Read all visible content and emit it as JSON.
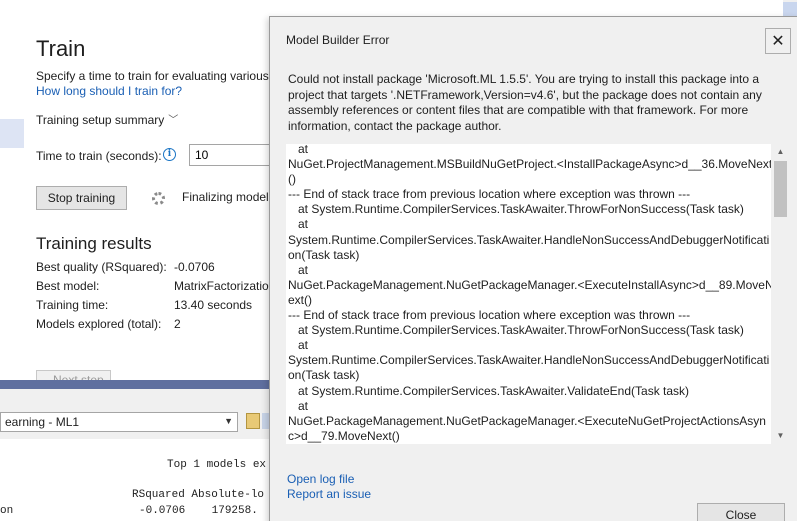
{
  "background": {
    "title": "Train",
    "subtitle": "Specify a time to train for evaluating various",
    "help_link": "How long should I train for?",
    "summary_label": "Training setup summary",
    "time_label": "Time to train (seconds):",
    "time_value": "10",
    "stop_button": "Stop training",
    "status_text": "Finalizing model",
    "results_title": "Training results",
    "results": [
      {
        "label": "Best quality (RSquared):",
        "value": "-0.0706"
      },
      {
        "label": "Best model:",
        "value": "MatrixFactorizatio"
      },
      {
        "label": "Training time:",
        "value": "13.40 seconds"
      },
      {
        "label": "Models explored (total):",
        "value": "2"
      }
    ],
    "next_button": "Next step"
  },
  "output": {
    "source_selected": "earning - ML1",
    "lines": [
      "Top 1 models ex",
      "RSquared Absolute-lo",
      "-0.0706    179258.",
      "on"
    ]
  },
  "dialog": {
    "title": "Model Builder Error",
    "close_x": "✕",
    "message_lines": [
      "Could not install package 'Microsoft.ML 1.5.5'. You are trying to install this package into a",
      "project that targets '.NETFramework,Version=v4.6', but the package does not contain any",
      "assembly references or content files that are compatible with that framework. For more",
      "information, contact the package author."
    ],
    "stack_lines": [
      "",
      "   at",
      "NuGet.ProjectManagement.MSBuildNuGetProject.<InstallPackageAsync>d__36.MoveNext",
      "()",
      "--- End of stack trace from previous location where exception was thrown ---",
      "   at System.Runtime.CompilerServices.TaskAwaiter.ThrowForNonSuccess(Task task)",
      "   at",
      "System.Runtime.CompilerServices.TaskAwaiter.HandleNonSuccessAndDebuggerNotificati",
      "on(Task task)",
      "   at",
      "NuGet.PackageManagement.NuGetPackageManager.<ExecuteInstallAsync>d__89.MoveN",
      "ext()",
      "--- End of stack trace from previous location where exception was thrown ---",
      "   at System.Runtime.CompilerServices.TaskAwaiter.ThrowForNonSuccess(Task task)",
      "   at",
      "System.Runtime.CompilerServices.TaskAwaiter.HandleNonSuccessAndDebuggerNotificati",
      "on(Task task)",
      "   at System.Runtime.CompilerServices.TaskAwaiter.ValidateEnd(Task task)",
      "   at",
      "NuGet.PackageManagement.NuGetPackageManager.<ExecuteNuGetProjectActionsAsyn",
      "c>d__79.MoveNext()"
    ],
    "open_log_link": "Open log file",
    "report_link": "Report an issue",
    "close_button": "Close"
  }
}
